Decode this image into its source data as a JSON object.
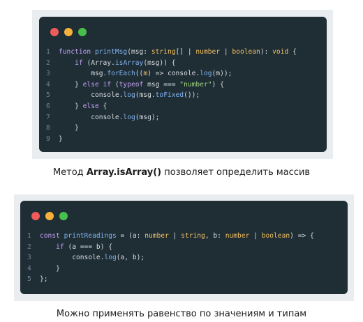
{
  "colors": {
    "dot_close": "#ef5b5b",
    "dot_minimize": "#f4b23a",
    "dot_maximize": "#46c04a",
    "keyword": "#c4a0f2",
    "function": "#80b4f0",
    "type": "#f0c060",
    "string": "#9fd47a",
    "plain": "#d7dde1"
  },
  "snippet1": {
    "lines": [
      {
        "n": "1",
        "tokens": [
          {
            "t": "function ",
            "c": "keyword"
          },
          {
            "t": "printMsg",
            "c": "function"
          },
          {
            "t": "(msg: ",
            "c": "plain"
          },
          {
            "t": "string",
            "c": "type"
          },
          {
            "t": "[] | ",
            "c": "plain"
          },
          {
            "t": "number",
            "c": "type"
          },
          {
            "t": " | ",
            "c": "plain"
          },
          {
            "t": "boolean",
            "c": "type"
          },
          {
            "t": "): ",
            "c": "plain"
          },
          {
            "t": "void",
            "c": "type"
          },
          {
            "t": " {",
            "c": "plain"
          }
        ]
      },
      {
        "n": "2",
        "tokens": [
          {
            "t": "    ",
            "c": "plain"
          },
          {
            "t": "if",
            "c": "keyword"
          },
          {
            "t": " (Array.",
            "c": "plain"
          },
          {
            "t": "isArray",
            "c": "function"
          },
          {
            "t": "(msg)) {",
            "c": "plain"
          }
        ]
      },
      {
        "n": "3",
        "tokens": [
          {
            "t": "        msg.",
            "c": "plain"
          },
          {
            "t": "forEach",
            "c": "function"
          },
          {
            "t": "((",
            "c": "plain"
          },
          {
            "t": "m",
            "c": "type"
          },
          {
            "t": ") => console.",
            "c": "plain"
          },
          {
            "t": "log",
            "c": "function"
          },
          {
            "t": "(m));",
            "c": "plain"
          }
        ]
      },
      {
        "n": "4",
        "tokens": [
          {
            "t": "    } ",
            "c": "plain"
          },
          {
            "t": "else if",
            "c": "keyword"
          },
          {
            "t": " (",
            "c": "plain"
          },
          {
            "t": "typeof",
            "c": "keyword"
          },
          {
            "t": " msg === ",
            "c": "plain"
          },
          {
            "t": "\"number\"",
            "c": "string"
          },
          {
            "t": ") {",
            "c": "plain"
          }
        ]
      },
      {
        "n": "5",
        "tokens": [
          {
            "t": "        console.",
            "c": "plain"
          },
          {
            "t": "log",
            "c": "function"
          },
          {
            "t": "(msg.",
            "c": "plain"
          },
          {
            "t": "toFixed",
            "c": "function"
          },
          {
            "t": "());",
            "c": "plain"
          }
        ]
      },
      {
        "n": "6",
        "tokens": [
          {
            "t": "    } ",
            "c": "plain"
          },
          {
            "t": "else",
            "c": "keyword"
          },
          {
            "t": " {",
            "c": "plain"
          }
        ]
      },
      {
        "n": "7",
        "tokens": [
          {
            "t": "        console.",
            "c": "plain"
          },
          {
            "t": "log",
            "c": "function"
          },
          {
            "t": "(msg);",
            "c": "plain"
          }
        ]
      },
      {
        "n": "8",
        "tokens": [
          {
            "t": "    }",
            "c": "plain"
          }
        ]
      },
      {
        "n": "9",
        "tokens": [
          {
            "t": "}",
            "c": "plain"
          }
        ]
      }
    ]
  },
  "caption1": {
    "before": "Метод ",
    "bold": "Array.isArray()",
    "after": " позволяет определить массив"
  },
  "snippet2": {
    "lines": [
      {
        "n": "1",
        "tokens": [
          {
            "t": "const ",
            "c": "keyword"
          },
          {
            "t": "printReadings",
            "c": "function"
          },
          {
            "t": " = (a: ",
            "c": "plain"
          },
          {
            "t": "number",
            "c": "type"
          },
          {
            "t": " | ",
            "c": "plain"
          },
          {
            "t": "string",
            "c": "type"
          },
          {
            "t": ", b: ",
            "c": "plain"
          },
          {
            "t": "number",
            "c": "type"
          },
          {
            "t": " | ",
            "c": "plain"
          },
          {
            "t": "boolean",
            "c": "type"
          },
          {
            "t": ") => {",
            "c": "plain"
          }
        ]
      },
      {
        "n": "2",
        "tokens": [
          {
            "t": "    ",
            "c": "plain"
          },
          {
            "t": "if",
            "c": "keyword"
          },
          {
            "t": " (a === b) {",
            "c": "plain"
          }
        ]
      },
      {
        "n": "3",
        "tokens": [
          {
            "t": "        console.",
            "c": "plain"
          },
          {
            "t": "log",
            "c": "function"
          },
          {
            "t": "(a, b);",
            "c": "plain"
          }
        ]
      },
      {
        "n": "4",
        "tokens": [
          {
            "t": "    }",
            "c": "plain"
          }
        ]
      },
      {
        "n": "5",
        "tokens": [
          {
            "t": "};",
            "c": "plain"
          }
        ]
      }
    ]
  },
  "caption2": {
    "text": "Можно применять равенство по значениям и типам"
  }
}
